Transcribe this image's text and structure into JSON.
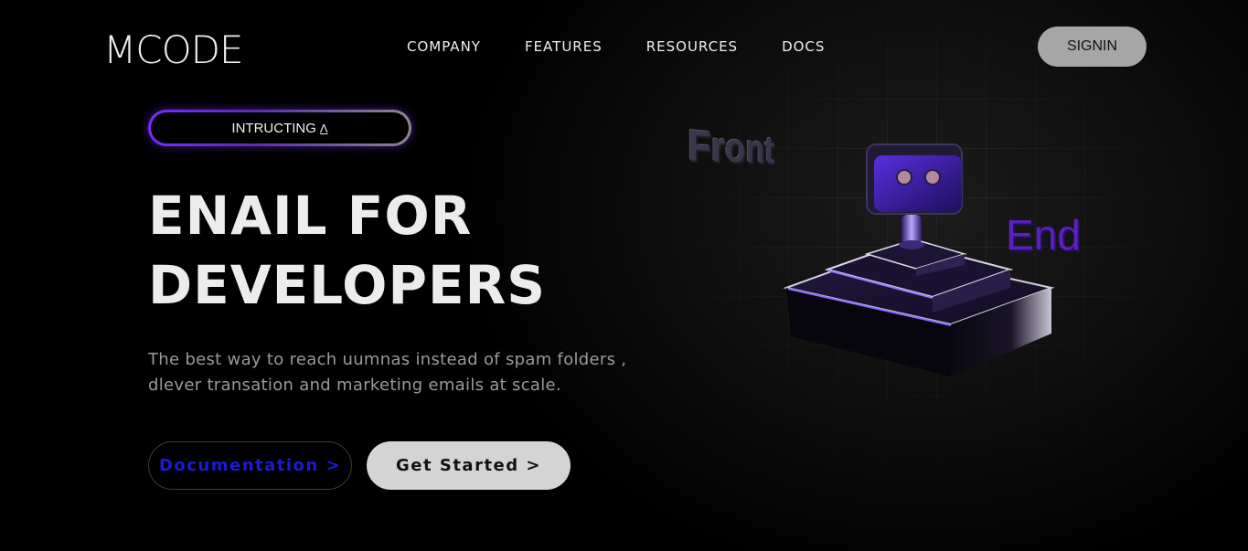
{
  "header": {
    "logo": "MCODE",
    "nav": [
      "COMPANY",
      "FEATURES",
      "RESOURCES",
      "DOCS"
    ],
    "signin_label": "SIGNIN"
  },
  "hero": {
    "badge_label": "INTRUCTING",
    "badge_icon": "caret-up-icon",
    "headline_line1": "ENAIL FOR",
    "headline_line2": "DEVELOPERS",
    "subtitle_line1": "The best way to reach uumnas instead of spam folders ,",
    "subtitle_line2": "dlever transation and marketing emails at scale.",
    "doc_button": "Documentation  >",
    "start_button": "Get Started  >"
  },
  "illustration": {
    "word_front": "Front",
    "word_end": "End",
    "object": "robot-on-podium-illustration"
  },
  "colors": {
    "background": "#000000",
    "accent_purple": "#7a2cff",
    "doc_text": "#1a1ad8",
    "signin_bg": "#a6a6a6",
    "start_bg": "#d4d4d4"
  }
}
